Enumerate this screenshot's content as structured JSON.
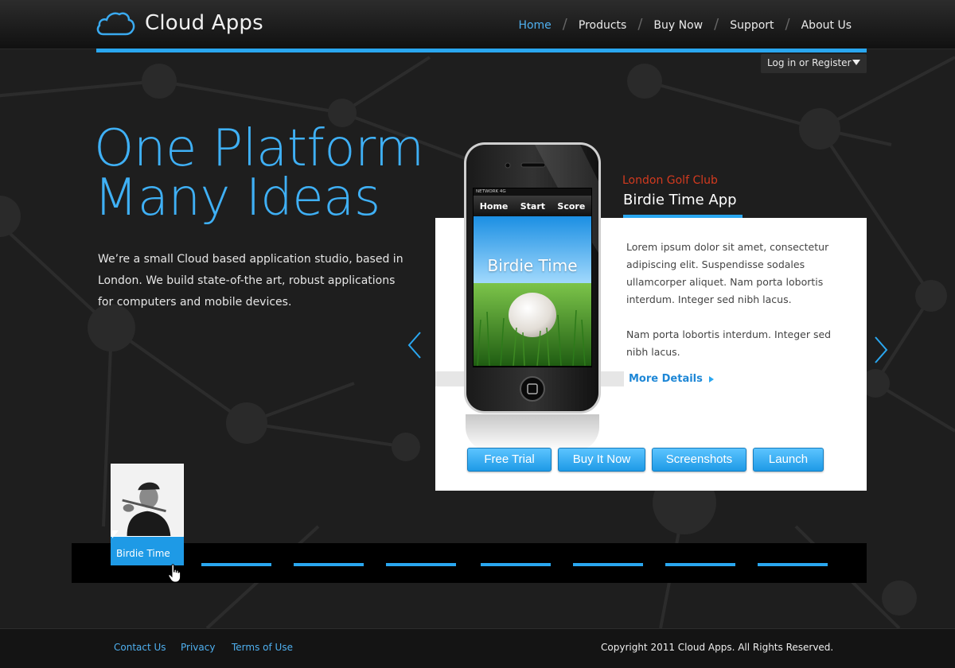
{
  "header": {
    "brand": "Cloud Apps",
    "nav": [
      {
        "label": "Home",
        "active": true
      },
      {
        "label": "Products"
      },
      {
        "label": "Buy Now"
      },
      {
        "label": "Support"
      },
      {
        "label": "About Us"
      }
    ],
    "nav_separator": "/",
    "login_label": "Log in or Register"
  },
  "hero": {
    "title_line1": "One Platform",
    "title_line2": "Many Ideas",
    "description": "We’re a small Cloud based application studio, based in London. We build state-of-the art, robust applications for computers and mobile devices."
  },
  "feature": {
    "client": "London Golf Club",
    "app_name": "Birdie Time App",
    "paragraph1": "Lorem ipsum dolor sit amet, consectetur adipiscing elit. Suspendisse sodales ullamcorper aliquet. Nam porta lobortis interdum. Integer sed nibh lacus.",
    "paragraph2": "Nam porta lobortis interdum. Integer sed nibh lacus.",
    "more_label": "More Details",
    "buttons": [
      "Free Trial",
      "Buy It Now",
      "Screenshots",
      "Launch"
    ],
    "phone": {
      "status": "NETWORK 4G",
      "tabs": [
        "Home",
        "Start",
        "Score"
      ],
      "screen_title": "Birdie Time"
    }
  },
  "carousel": {
    "active_label": "Birdie Time"
  },
  "footer": {
    "links": [
      "Contact Us",
      "Privacy",
      "Terms of Use"
    ],
    "copyright": "Copyright 2011 Cloud Apps. All Rights Reserved."
  },
  "colors": {
    "accent": "#2aa7f0",
    "client_red": "#d23a1f",
    "background": "#1e1e1e"
  }
}
